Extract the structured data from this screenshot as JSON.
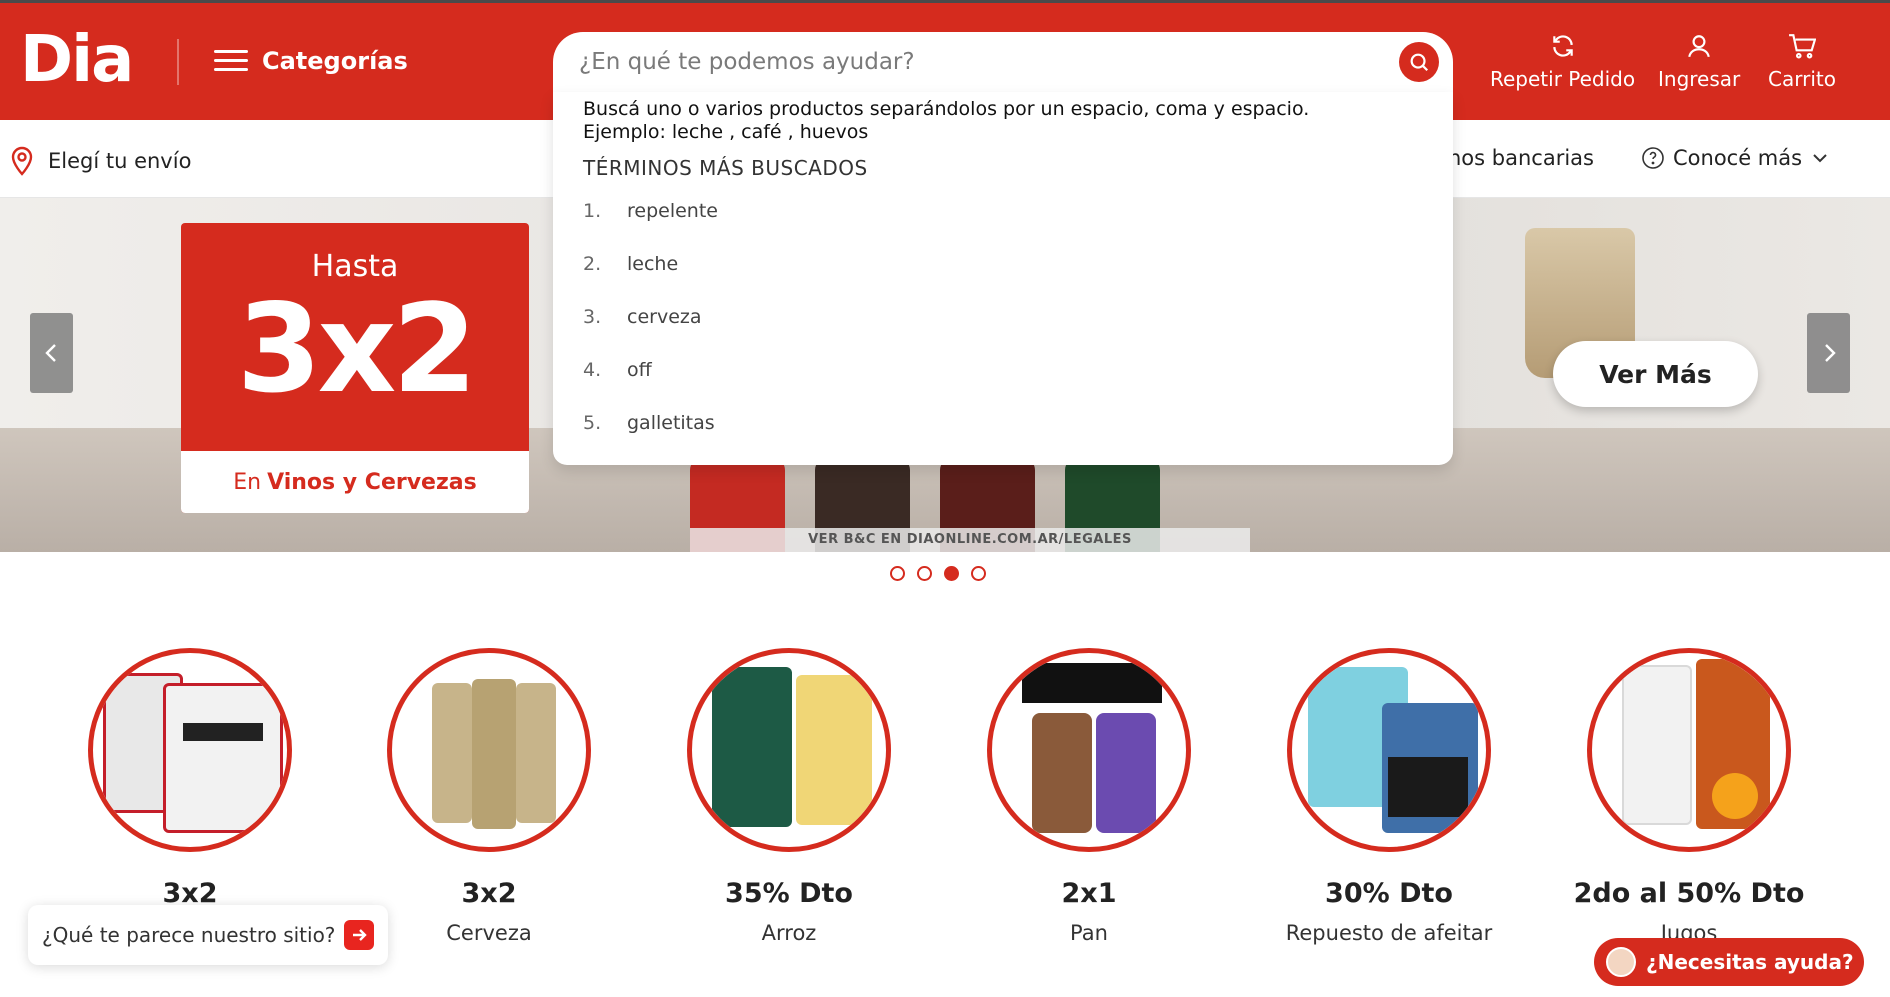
{
  "header": {
    "logo": "Dia",
    "categories_label": "Categorías",
    "search_placeholder": "¿En qué te podemos ayudar?",
    "actions": [
      {
        "label": "Repetir Pedido",
        "icon": "refresh-icon"
      },
      {
        "label": "Ingresar",
        "icon": "user-icon"
      },
      {
        "label": "Carrito",
        "icon": "cart-icon"
      }
    ],
    "brand_color": "#d52b1e"
  },
  "subnav": {
    "shipping_label": "Elegí tu envío",
    "links": [
      "nos bancarias",
      "Conocé más"
    ]
  },
  "search_dropdown": {
    "hint_line1": "Buscá uno o varios productos separándolos por un espacio, coma y espacio.",
    "hint_line2": "Ejemplo: leche , café , huevos",
    "title": "TÉRMINOS MÁS BUSCADOS",
    "terms": [
      {
        "num": "1.",
        "text": "repelente"
      },
      {
        "num": "2.",
        "text": "leche"
      },
      {
        "num": "3.",
        "text": "cerveza"
      },
      {
        "num": "4.",
        "text": "off"
      },
      {
        "num": "5.",
        "text": "galletitas"
      }
    ]
  },
  "banner": {
    "hasta": "Hasta",
    "big": "3x2",
    "foot_prefix": "En",
    "foot_bold": "Vinos y Cervezas",
    "legal": "VER B&C EN DIAONLINE.COM.AR/LEGALES",
    "cta": "Ver Más",
    "active_slide": 3,
    "slide_count": 4
  },
  "categories": [
    {
      "offer": "3x2",
      "name": "",
      "icon": "batteries-icon"
    },
    {
      "offer": "3x2",
      "name": "Cerveza",
      "icon": "beer-cans-icon"
    },
    {
      "offer": "35% Dto",
      "name": "Arroz",
      "icon": "rice-icon"
    },
    {
      "offer": "2x1",
      "name": "Pan",
      "icon": "bread-icon"
    },
    {
      "offer": "30% Dto",
      "name": "Repuesto de afeitar",
      "icon": "razor-icon"
    },
    {
      "offer": "2do al 50% Dto",
      "name": "Jugos",
      "icon": "juice-icon"
    }
  ],
  "feedback": {
    "label": "¿Qué te parece nuestro sitio?"
  },
  "help": {
    "label": "¿Necesitas ayuda?"
  }
}
